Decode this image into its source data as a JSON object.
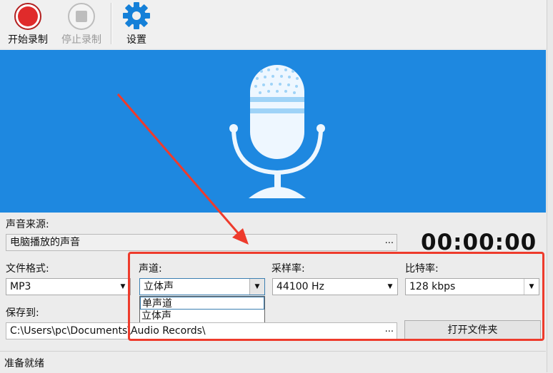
{
  "toolbar": {
    "start_label": "开始录制",
    "stop_label": "停止录制",
    "settings_label": "设置"
  },
  "icons": {
    "start": "record-icon",
    "stop": "stop-icon",
    "settings": "gear-icon",
    "banner": "microphone-icon"
  },
  "colors": {
    "banner": "#1e88e0",
    "record": "#e02b2b",
    "annotation": "#ee3b2c"
  },
  "source": {
    "label": "声音来源:",
    "value": "电脑播放的声音",
    "browse": "..."
  },
  "timer": "00:00:00",
  "format": {
    "label": "文件格式:",
    "value": "MP3"
  },
  "channel": {
    "label": "声道:",
    "value": "立体声",
    "options": [
      "单声道",
      "立体声"
    ],
    "highlighted": "单声道"
  },
  "sample_rate": {
    "label": "采样率:",
    "value": "44100 Hz"
  },
  "bitrate": {
    "label": "比特率:",
    "value": "128 kbps"
  },
  "save": {
    "label": "保存到:",
    "path": "C:\\Users\\pc\\Documents\\Audio Records\\",
    "browse": "...",
    "open_folder": "打开文件夹"
  },
  "status": "准备就绪"
}
